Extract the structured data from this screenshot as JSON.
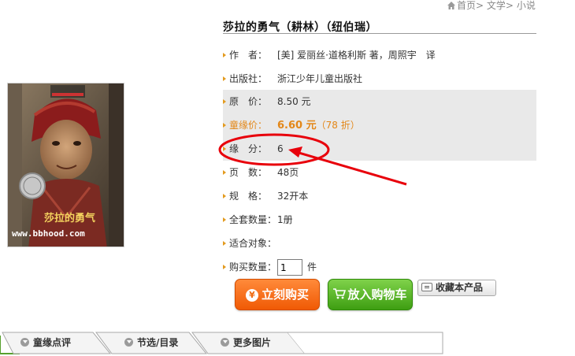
{
  "breadcrumb": {
    "home": "首页",
    "sep": ">",
    "cat": "文学",
    "sub": "小说"
  },
  "book": {
    "title": "莎拉的勇气（耕林）（纽伯瑞）",
    "cover_title": "莎拉的勇气",
    "cover_watermark": "www.bbhood.com"
  },
  "info": {
    "author": {
      "label": "作　者：",
      "value": "[美] 爱丽丝·道格利斯 著，周照宇　译"
    },
    "publisher": {
      "label": "出版社：",
      "value": "浙江少年儿童出版社"
    },
    "original_price": {
      "label": "原　价：",
      "value": "8.50 元"
    },
    "member_price": {
      "label": "童缘价：",
      "value": "6.60 元",
      "discount": "（78 折）"
    },
    "points": {
      "label": "缘　分：",
      "value": "6"
    },
    "pages": {
      "label": "页　数：",
      "value": "48页"
    },
    "format": {
      "label": "规　格：",
      "value": "32开本"
    },
    "set_count": {
      "label": "全套数量：",
      "value": "1册"
    },
    "audience": {
      "label": "适合对象：",
      "value": ""
    },
    "quantity": {
      "label": "购买数量：",
      "value": "1",
      "unit": "件"
    }
  },
  "buttons": {
    "buy": "立刻购买",
    "cart": "放入购物车",
    "favorite": "收藏本产品"
  },
  "tabs": [
    {
      "label": "童缘点评"
    },
    {
      "label": "节选/目录"
    },
    {
      "label": "更多图片"
    }
  ],
  "colors": {
    "accent_orange": "#e38718",
    "buy_button": "#f05a05",
    "cart_button": "#3e9e12",
    "annotation_red": "#e8000b",
    "row_gray": "#e9e9e9"
  }
}
